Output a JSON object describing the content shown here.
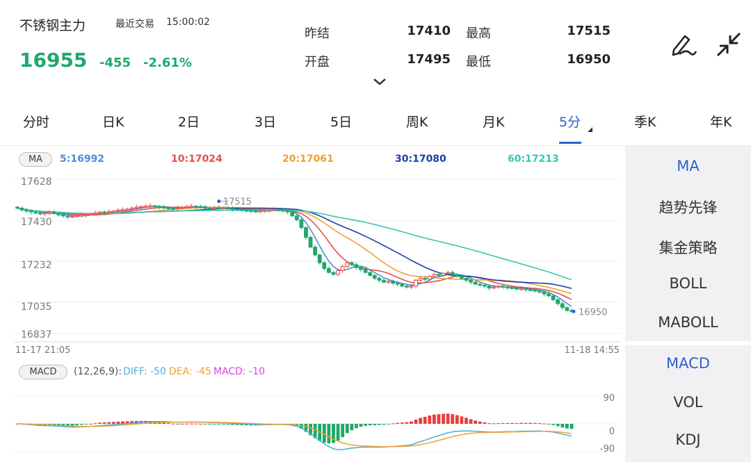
{
  "header": {
    "name": "不锈钢主力",
    "last_trade_label": "最近交易",
    "last_trade_time": "15:00:02",
    "price": "16955",
    "change": "-455",
    "change_pct": "-2.61%",
    "stats": [
      {
        "label": "昨结",
        "value": "17410"
      },
      {
        "label": "开盘",
        "value": "17495"
      },
      {
        "label": "最高",
        "value": "17515"
      },
      {
        "label": "最低",
        "value": "16950"
      }
    ],
    "icons": [
      "pencil-icon",
      "collapse-icon",
      "chevron-down-icon"
    ]
  },
  "tabs": [
    "分时",
    "日K",
    "2日",
    "3日",
    "5日",
    "周K",
    "月K",
    "5分",
    "季K",
    "年K"
  ],
  "active_tab": "5分",
  "ma_bar": {
    "badge": "MA",
    "items": [
      {
        "label": "5:16992",
        "color": "#4a90d9"
      },
      {
        "label": "10:17024",
        "color": "#e35050"
      },
      {
        "label": "20:17061",
        "color": "#f0a030"
      },
      {
        "label": "30:17080",
        "color": "#1a3faa"
      },
      {
        "label": "60:17213",
        "color": "#33c9b0"
      }
    ]
  },
  "price_axis": [
    "17628",
    "17430",
    "17232",
    "17035",
    "16837"
  ],
  "time_axis": {
    "start": "11-17 21:05",
    "end": "11-18 14:55"
  },
  "annotations": {
    "high": "17515",
    "last": "16950"
  },
  "macd_bar": {
    "badge": "MACD",
    "params": "(12,26,9):",
    "diff": "DIFF: -50",
    "dea": "DEA: -45",
    "macd": "MACD: -10",
    "diff_color": "#4aaed9",
    "dea_color": "#f0a030",
    "macd_color": "#e040e0"
  },
  "macd_axis": [
    "90",
    "0",
    "-90"
  ],
  "side_main": [
    "MA",
    "趋势先锋",
    "集金策略",
    "BOLL",
    "MABOLL"
  ],
  "side_sub": [
    "MACD",
    "VOL",
    "KDJ"
  ],
  "colors": {
    "up": "#e83e3e",
    "down": "#1fa86a",
    "accent": "#2d62c8"
  },
  "chart_data": {
    "type": "candlestick",
    "interval": "5分",
    "ylim": [
      16837,
      17628
    ],
    "close": [
      17480,
      17470,
      17465,
      17460,
      17455,
      17450,
      17455,
      17458,
      17452,
      17445,
      17440,
      17435,
      17438,
      17442,
      17445,
      17448,
      17450,
      17455,
      17460,
      17458,
      17462,
      17465,
      17470,
      17472,
      17475,
      17480,
      17485,
      17488,
      17490,
      17492,
      17488,
      17485,
      17482,
      17478,
      17475,
      17480,
      17485,
      17488,
      17490,
      17488,
      17485,
      17480,
      17478,
      17482,
      17480,
      17482,
      17478,
      17474,
      17473,
      17470,
      17468,
      17465,
      17462,
      17466,
      17468,
      17470,
      17472,
      17470,
      17468,
      17460,
      17440,
      17420,
      17380,
      17330,
      17280,
      17240,
      17200,
      17170,
      17150,
      17140,
      17160,
      17180,
      17200,
      17190,
      17175,
      17165,
      17150,
      17135,
      17120,
      17110,
      17100,
      17105,
      17095,
      17090,
      17080,
      17075,
      17080,
      17110,
      17120,
      17115,
      17130,
      17140,
      17135,
      17145,
      17150,
      17140,
      17130,
      17120,
      17110,
      17100,
      17090,
      17085,
      17080,
      17070,
      17075,
      17080,
      17076,
      17072,
      17070,
      17065,
      17068,
      17062,
      17060,
      17055,
      17050,
      17040,
      17030,
      17010,
      16990,
      16970,
      16955,
      16950
    ],
    "ma": {
      "5": "16992",
      "10": "17024",
      "20": "17061",
      "30": "17080",
      "60": "17213"
    },
    "macd": {
      "diff": -50,
      "dea": -45,
      "hist": -10
    }
  }
}
